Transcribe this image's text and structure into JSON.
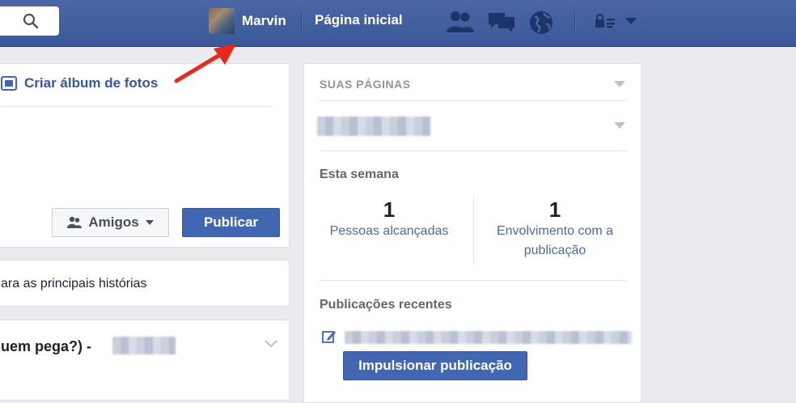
{
  "topbar": {
    "profile_name": "Marvin",
    "home_label": "Página inicial",
    "icons": [
      "search-icon",
      "friend-requests-icon",
      "messages-icon",
      "notifications-globe-icon",
      "privacy-lock-icon",
      "account-menu-icon"
    ]
  },
  "composer": {
    "album_label": "Criar álbum de fotos",
    "audience_label": "Amigos",
    "publish_label": "Publicar"
  },
  "feed": {
    "stories_text": "ara as principais histórias",
    "post_title": "uem pega?) -"
  },
  "pages_panel": {
    "header": "SUAS PÁGINAS",
    "week_label": "Esta semana",
    "stats": [
      {
        "value": "1",
        "label_line1": "Pessoas alcançadas",
        "label_line2": ""
      },
      {
        "value": "1",
        "label_line1": "Envolvimento com a",
        "label_line2": "publicação"
      }
    ],
    "recent_label": "Publicações recentes",
    "boost_label": "Impulsionar publicação"
  },
  "colors": {
    "topbar": "#3b5998",
    "button": "#4267b2",
    "link": "#365899",
    "annotation_arrow": "#e8271d"
  }
}
